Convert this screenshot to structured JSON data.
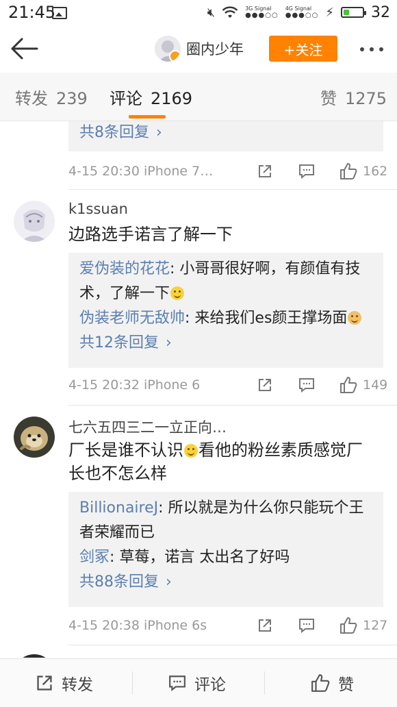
{
  "status_bar": {
    "time": "21:45",
    "sig_3g": "3G Signal",
    "sig_4g": "4G Signal",
    "battery_pct": "32",
    "battery_level": 0.3
  },
  "header": {
    "title": "圈内少年",
    "follow_label": "+关注"
  },
  "tabs": [
    {
      "label": "转发",
      "count": "239"
    },
    {
      "label": "评论",
      "count": "2169"
    },
    {
      "label": "赞",
      "count": "1275"
    }
  ],
  "comments": [
    {
      "reply_more": "共8条回复",
      "meta": {
        "when": "4-15 20:30 iPhone 7…",
        "likes": "162"
      }
    },
    {
      "name": "k1ssuan",
      "text": "边路选手诺言了解一下",
      "replies": [
        {
          "name": "爱伪装的花花",
          "text": "小哥哥很好啊，有颜值有技术，了解一下"
        },
        {
          "name": "伪装老师无敌帅",
          "text": "来给我们es颜王撑场面"
        }
      ],
      "reply_more": "共12条回复",
      "meta": {
        "when": "4-15 20:32 iPhone 6",
        "likes": "149"
      }
    },
    {
      "name": "七六五四三二一立正向…",
      "text_a": "厂长是谁不认识",
      "text_b": "看他的粉丝素质感觉厂长也不怎么样",
      "replies": [
        {
          "name": "BillionaireJ",
          "text": "所以就是为什么你只能玩个王者荣耀而已"
        },
        {
          "name": "剑冢",
          "text": "草莓，诺言  太出名了好吗"
        }
      ],
      "reply_more": "共88条回复",
      "meta": {
        "when": "4-15 20:38 iPhone 6s",
        "likes": "127"
      }
    }
  ],
  "bottom_bar": {
    "repost": "转发",
    "comment": "评论",
    "like": "赞"
  },
  "colors": {
    "accent": "#ff8200",
    "link": "#5a7fb0"
  }
}
